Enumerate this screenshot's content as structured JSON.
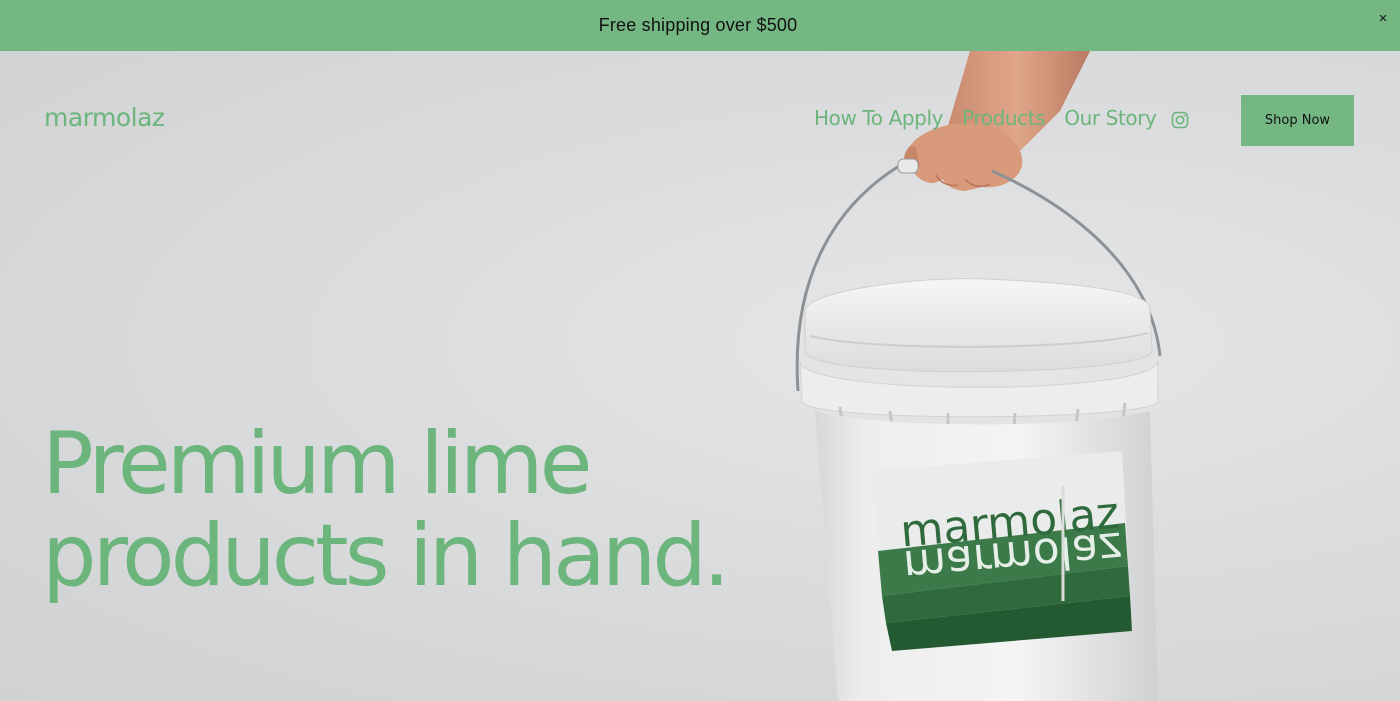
{
  "announcement": {
    "text": "Free shipping over $500",
    "close_label": "×"
  },
  "header": {
    "logo": "marmolaz",
    "nav": [
      {
        "label": "How To Apply"
      },
      {
        "label": "Products"
      },
      {
        "label": "Our Story"
      }
    ],
    "social_icon": "instagram-icon",
    "cta_label": "Shop Now"
  },
  "hero": {
    "headline_line1": "Premium lime",
    "headline_line2": "products in hand.",
    "bucket_label": "marmolaz",
    "bucket_label_reflection": "marmolaz"
  },
  "colors": {
    "brand_green": "#74b783",
    "text_green": "#6cb57c",
    "label_green_dark": "#2f6a3d",
    "background": "#d9dadb"
  }
}
